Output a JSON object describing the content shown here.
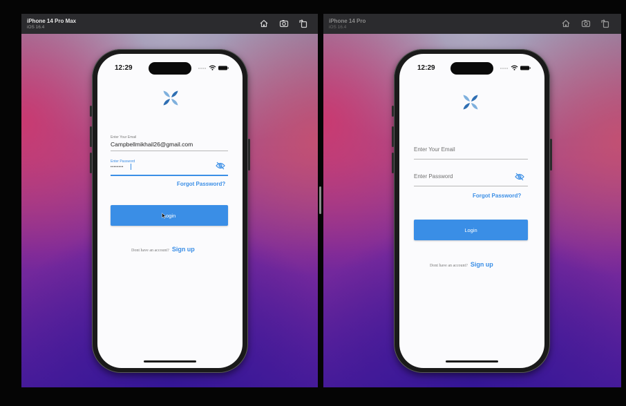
{
  "simulators": {
    "max": {
      "device": "iPhone 14 Pro Max",
      "os": "iOS 16.4",
      "time": "12:29",
      "email_label": "Enter Your Email",
      "email_value": "Campbellmikhail26@gmail.com",
      "password_label": "Enter Password",
      "password_masked": "••••••••",
      "forgot": "Forgot Password?",
      "login": "Login",
      "signup_question": "Dont have an account?",
      "signup": "Sign up"
    },
    "pro": {
      "device": "iPhone 14 Pro",
      "os": "iOS 16.4",
      "time": "12:29",
      "email_placeholder": "Enter Your Email",
      "password_placeholder": "Enter Password",
      "forgot": "Forgot Password?",
      "login": "Login",
      "signup_question": "Dont have an account?",
      "signup": "Sign up"
    }
  },
  "toolbar_icons": [
    "home-icon",
    "screenshot-icon",
    "rotate-icon"
  ],
  "colors": {
    "accent": "#3a8ee6",
    "screen_bg": "#fbfbfd",
    "titlebar": "#2b2b2e"
  }
}
